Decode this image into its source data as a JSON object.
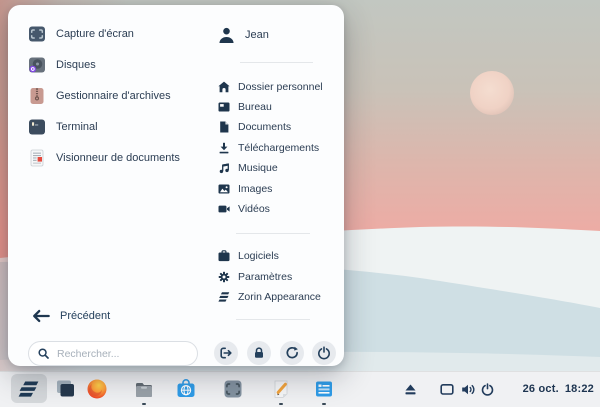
{
  "menu": {
    "apps": [
      {
        "label": "Capture d'écran"
      },
      {
        "label": "Disques"
      },
      {
        "label": "Gestionnaire d'archives"
      },
      {
        "label": "Terminal"
      },
      {
        "label": "Visionneur de documents"
      }
    ],
    "user": {
      "name": "Jean"
    },
    "places": [
      {
        "label": "Dossier personnel"
      },
      {
        "label": "Bureau"
      },
      {
        "label": "Documents"
      },
      {
        "label": "Téléchargements"
      },
      {
        "label": "Musique"
      },
      {
        "label": "Images"
      },
      {
        "label": "Vidéos"
      }
    ],
    "system": [
      {
        "label": "Logiciels"
      },
      {
        "label": "Paramètres"
      },
      {
        "label": "Zorin Appearance"
      }
    ],
    "back_label": "Précédent",
    "search_placeholder": "Rechercher...",
    "session_buttons": [
      "logout",
      "lock",
      "restart",
      "power"
    ]
  },
  "taskbar": {
    "items": [
      "zorin-menu",
      "window-switcher",
      "firefox",
      "files",
      "software",
      "screenshot-tool",
      "text-editor",
      "checklist"
    ],
    "running_indicators": [
      "files",
      "text-editor",
      "checklist"
    ],
    "tray": [
      "eject",
      "display",
      "volume",
      "power"
    ],
    "clock": {
      "date": "26 oct.",
      "time": "18:22"
    }
  },
  "colors": {
    "navy": "#1f3750",
    "menu_bg": "#fcfdfe",
    "taskbar_bg": "#f0f1f3",
    "software_blue": "#2f9ce8",
    "archive_tan": "#c89a91",
    "disks_badge_purple": "#8247e5",
    "pencil_orange": "#f2a33c",
    "doc_red": "#e64a3e",
    "sky_pink": "#eeaba4",
    "dune_white": "#eff3f3",
    "dune_shadow": "#cfdfe4"
  }
}
